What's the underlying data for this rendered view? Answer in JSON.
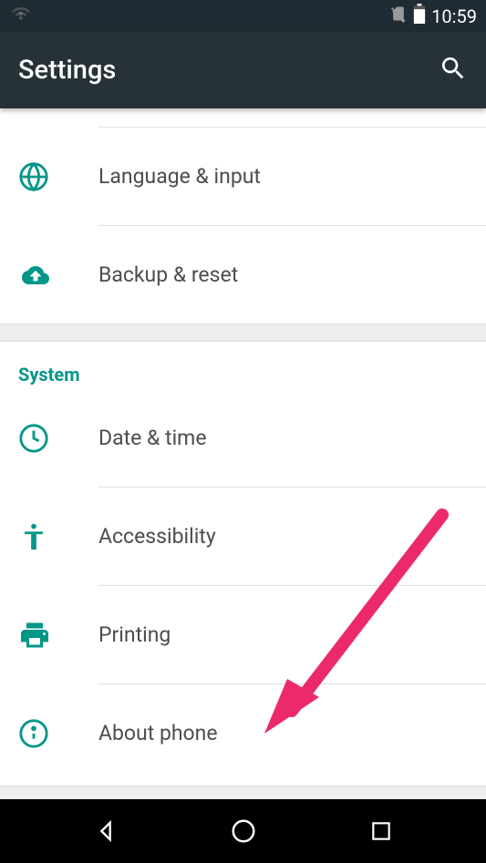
{
  "statusBar": {
    "time": "10:59"
  },
  "appBar": {
    "title": "Settings"
  },
  "group1": {
    "items": [
      {
        "icon": "globe",
        "label": "Language & input"
      },
      {
        "icon": "cloud-upload",
        "label": "Backup & reset"
      }
    ]
  },
  "section": {
    "header": "System",
    "items": [
      {
        "icon": "clock",
        "label": "Date & time"
      },
      {
        "icon": "accessibility",
        "label": "Accessibility"
      },
      {
        "icon": "printer",
        "label": "Printing"
      },
      {
        "icon": "info",
        "label": "About phone"
      }
    ]
  }
}
